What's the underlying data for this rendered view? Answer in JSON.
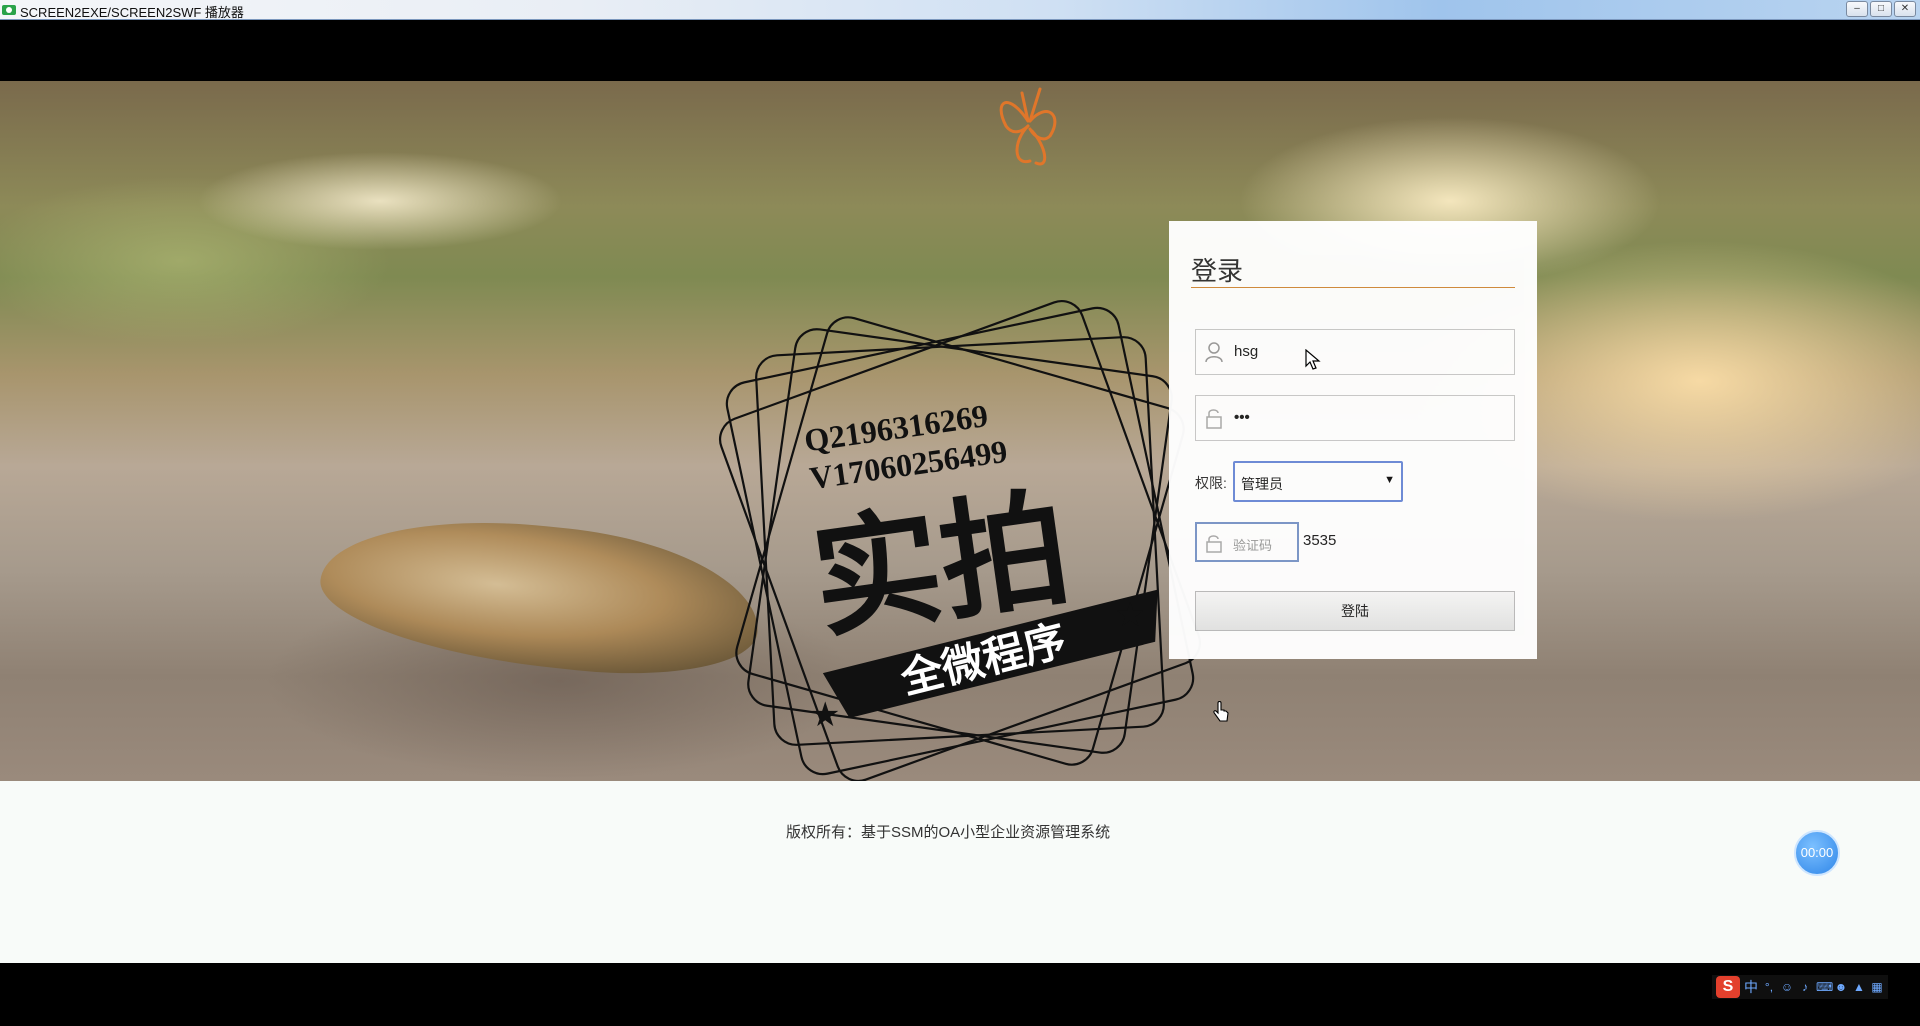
{
  "window": {
    "title": "SCREEN2EXE/SCREEN2SWF 播放器",
    "buttons": [
      "minimize",
      "maximize",
      "close"
    ]
  },
  "watermark": {
    "line1": "Q2196316269",
    "line2": "V17060256499",
    "big_text": "实拍",
    "banner_text": "全微程序"
  },
  "login": {
    "title": "登录",
    "username_value": "hsg",
    "password_value": "•••",
    "permission_label": "权限:",
    "permission_selected": "管理员",
    "captcha_placeholder": "验证码",
    "captcha_code": "3535",
    "submit_label": "登陆"
  },
  "footer": {
    "copyright": "版权所有：基于SSM的OA小型企业资源管理系统"
  },
  "player": {
    "timer": "00:00"
  },
  "ime": {
    "logo": "S",
    "mode": "中",
    "icons": [
      "punctuation-icon",
      "emoji-icon",
      "mic-icon",
      "keyboard-icon",
      "user-icon",
      "skin-icon",
      "grid-icon"
    ]
  },
  "colors": {
    "title_underline": "#d28a3c",
    "select_border": "#6c8bd8",
    "timer_bg": "#2f86e8"
  }
}
